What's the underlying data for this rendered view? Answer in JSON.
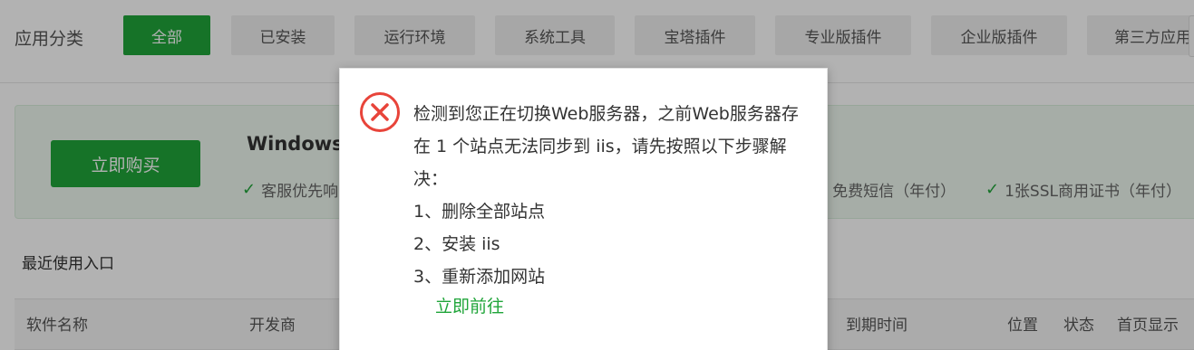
{
  "categories": {
    "label": "应用分类",
    "items": [
      "全部",
      "已安装",
      "运行环境",
      "系统工具",
      "宝塔插件",
      "专业版插件",
      "企业版插件",
      "第三方应用"
    ],
    "active_index": 0
  },
  "promo": {
    "buy_label": "立即购买",
    "title": "Windows",
    "benefits": [
      "客服优先响",
      "免费短信（年付）",
      "1张SSL商用证书（年付）"
    ]
  },
  "recent": {
    "title": "最近使用入口"
  },
  "table": {
    "headers": [
      "软件名称",
      "开发商",
      "到期时间",
      "位置",
      "状态",
      "首页显示"
    ]
  },
  "dialog": {
    "message": "检测到您正在切换Web服务器，之前Web服务器存在 1 个站点无法同步到 iis，请先按照以下步骤解决：",
    "steps": [
      "1、删除全部站点",
      "2、安装 iis",
      "3、重新添加网站"
    ],
    "link_label": "立即前往"
  },
  "colors": {
    "accent": "#20a53a",
    "error": "#e8443a"
  }
}
